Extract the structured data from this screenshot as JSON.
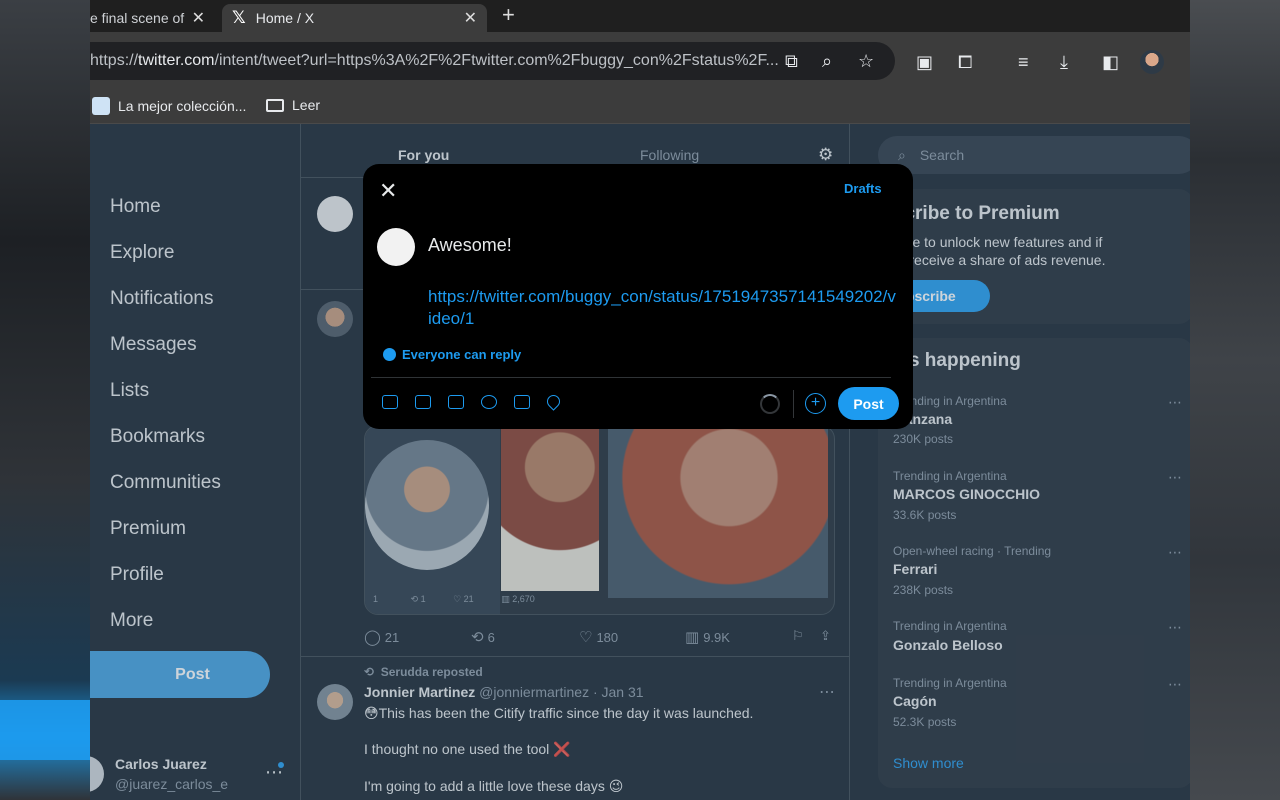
{
  "browser": {
    "tab_inactive": "e final scene of",
    "tab_active": "Home / X",
    "close_symbol": "✕",
    "new_tab_symbol": "+",
    "url_prefix": "https://",
    "url_host": "twitter.com",
    "url_rest": "/intent/tweet?url=https%3A%2F%2Ftwitter.com%2Fbuggy_con%2Fstatus%2F...",
    "bookmarks": [
      "La mejor colección...",
      "Leer"
    ]
  },
  "sidebar": {
    "items": [
      "Home",
      "Explore",
      "Notifications",
      "Messages",
      "Lists",
      "Bookmarks",
      "Communities",
      "Premium",
      "Profile",
      "More"
    ],
    "post_label": "Post",
    "account_name": "Carlos Juarez",
    "account_handle": "@juarez_carlos_e"
  },
  "timeline": {
    "tabs": [
      "For you",
      "Following"
    ],
    "media_stats": [
      "1",
      "21",
      "2,670"
    ],
    "actions": {
      "replies": "21",
      "reposts": "6",
      "likes": "180",
      "views": "9.9K"
    },
    "repost_line": "Serudda reposted",
    "tweet_name": "Jonnier Martinez",
    "tweet_meta": "@jonniermartinez · Jan 31",
    "tweet_lines": [
      "😳This has been the Citify traffic since the day it was launched.",
      "I thought no one used the tool ❌",
      "I'm going to add a little love these days 😉"
    ]
  },
  "right": {
    "search_placeholder": "Search",
    "premium_title": "Subscribe to Premium",
    "premium_text": "Subscribe to unlock new features and if eligible, receive a share of ads revenue.",
    "subscribe_label": "Subscribe",
    "happening_title": "What's happening",
    "trends": [
      {
        "meta": "Trending in Argentina",
        "title": "Manzana",
        "count": "230K posts"
      },
      {
        "meta": "Trending in Argentina",
        "title": "MARCOS GINOCCHIO",
        "count": "33.6K posts"
      },
      {
        "meta": "Open-wheel racing · Trending",
        "title": "Ferrari",
        "count": "238K posts"
      },
      {
        "meta": "Trending in Argentina",
        "title": "Gonzalo Belloso",
        "count": ""
      },
      {
        "meta": "Trending in Argentina",
        "title": "Cagón",
        "count": "52.3K posts"
      }
    ],
    "show_more": "Show more"
  },
  "compose": {
    "drafts": "Drafts",
    "text": "Awesome!",
    "link": "https://twitter.com/buggy_con/status/1751947357141549202/video/1",
    "reply_setting": "Everyone can reply",
    "post_label": "Post"
  },
  "colors": {
    "accent": "#1d9bf0",
    "background": "#15202b",
    "modal": "#000000"
  }
}
